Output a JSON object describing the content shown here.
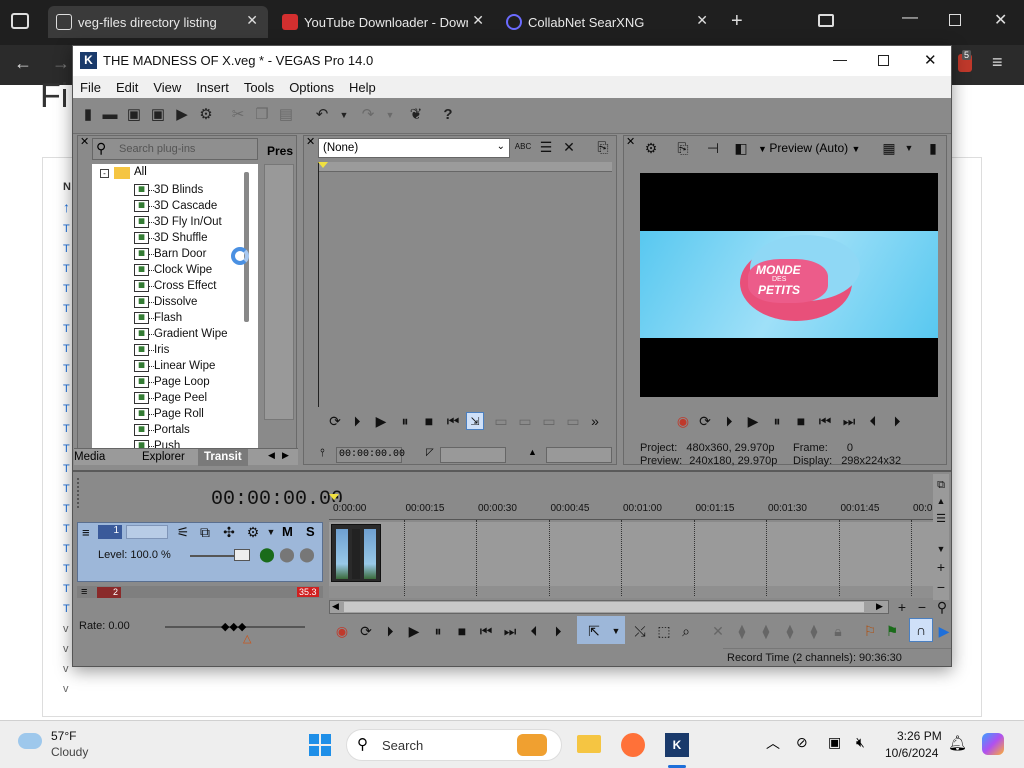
{
  "browser": {
    "tabs": [
      {
        "label": "veg-files directory listing",
        "active": true
      },
      {
        "label": "YouTube Downloader - Downlo",
        "active": false
      },
      {
        "label": "CollabNet SearXNG",
        "active": false
      }
    ],
    "ext_badge": "5"
  },
  "webpage": {
    "title_partial": "Fi",
    "col_head": "N",
    "rows": [
      "T",
      "T",
      "T",
      "T",
      "T",
      "T",
      "T",
      "T",
      "T",
      "T",
      "T",
      "T",
      "T",
      "T",
      "T",
      "T",
      "T",
      "T",
      "T",
      "T",
      "v",
      "v",
      "v",
      "v"
    ]
  },
  "vegas": {
    "title": "THE MADNESS OF X.veg * - VEGAS Pro 14.0",
    "menu": [
      "File",
      "Edit",
      "View",
      "Insert",
      "Tools",
      "Options",
      "Help"
    ],
    "plugins": {
      "search_placeholder": "Search plug-ins",
      "presets_label": "Pres",
      "root": "All",
      "items": [
        "3D Blinds",
        "3D Cascade",
        "3D Fly In/Out",
        "3D Shuffle",
        "Barn Door",
        "Clock Wipe",
        "Cross Effect",
        "Dissolve",
        "Flash",
        "Gradient Wipe",
        "Iris",
        "Linear Wipe",
        "Page Loop",
        "Page Peel",
        "Page Roll",
        "Portals",
        "Push"
      ],
      "tabs": [
        "Media",
        "Explorer",
        "Transit"
      ]
    },
    "trimmer": {
      "dropdown": "(None)",
      "timecode": "00:00:00.00"
    },
    "preview": {
      "mode": "Preview (Auto)",
      "logo_line1": "MONDE",
      "logo_line2": "DES",
      "logo_line3": "PETITS",
      "project_label": "Project:",
      "project_value": "480x360, 29.970p",
      "preview_label": "Preview:",
      "preview_value": "240x180, 29.970p",
      "frame_label": "Frame:",
      "frame_value": "0",
      "display_label": "Display:",
      "display_value": "298x224x32"
    },
    "timeline": {
      "timecode": "00:00:00.00",
      "ruler": [
        "0:00:00",
        "00:00:15",
        "00:00:30",
        "00:00:45",
        "00:01:00",
        "00:01:15",
        "00:01:30",
        "00:01:45",
        "00:0"
      ],
      "track1_number": "1",
      "track_level": "Level: 100.0 %",
      "track2_number": "2",
      "track2_badge": "35.3",
      "rate": "Rate: 0.00",
      "status": "Record Time (2 channels): 90:36:30",
      "m_label": "M",
      "s_label": "S"
    }
  },
  "taskbar": {
    "temp": "57°F",
    "weather": "Cloudy",
    "search": "Search",
    "time": "3:26 PM",
    "date": "10/6/2024"
  },
  "colors": {
    "accent": "#1e6fd9",
    "vegas_bg": "#8a8a8a",
    "track_blue": "#9db7d9"
  }
}
